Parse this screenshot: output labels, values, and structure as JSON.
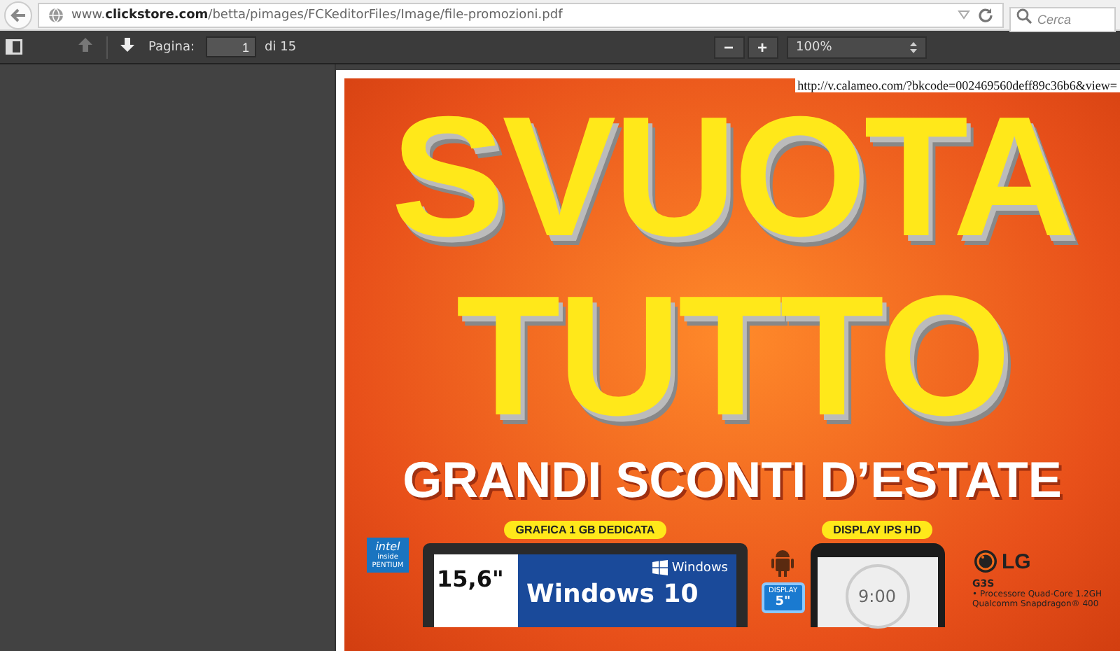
{
  "address_bar": {
    "url": "www.**clickstore.com**/betta/pimages/FCKeditorFiles/Image/file-promozioni.pdf",
    "search": {
      "placeholder": "Cerca"
    }
  },
  "pdf_toolbar": {
    "nav_buttons": [
      {
        "kind": "up",
        "disabled": true
      },
      {
        "kind": "down",
        "disabled": false
      }
    ],
    "page_label": "Pagina:",
    "page_value": "1",
    "page_total": "di 15",
    "zoom_buttons": [
      "−",
      "+"
    ],
    "zoom_value": "100%"
  },
  "document": {
    "overlay_link": "http://v.calameo.com/?bkcode=002469560deff89c36b6&view=",
    "headline": [
      "SVUOTA",
      "TUTTO"
    ],
    "subheadline": "GRANDI SCONTI D’ESTATE",
    "laptop": {
      "badge": "GRAFICA 1 GB DEDICATA",
      "size": "15,6\"",
      "os_logo": "Windows",
      "os_title": "Windows 10",
      "cpu_badge": [
        "intel",
        "inside",
        "PENTIUM"
      ]
    },
    "phone": {
      "badge": "DISPLAY IPS HD",
      "clock": "9:00",
      "display_badge": [
        "DISPLAY",
        "5\""
      ],
      "brand": "LG",
      "model": "G3S",
      "specs": [
        "• Processore Quad-Core 1.2GH",
        "Qualcomm Snapdragon® 400"
      ]
    }
  }
}
